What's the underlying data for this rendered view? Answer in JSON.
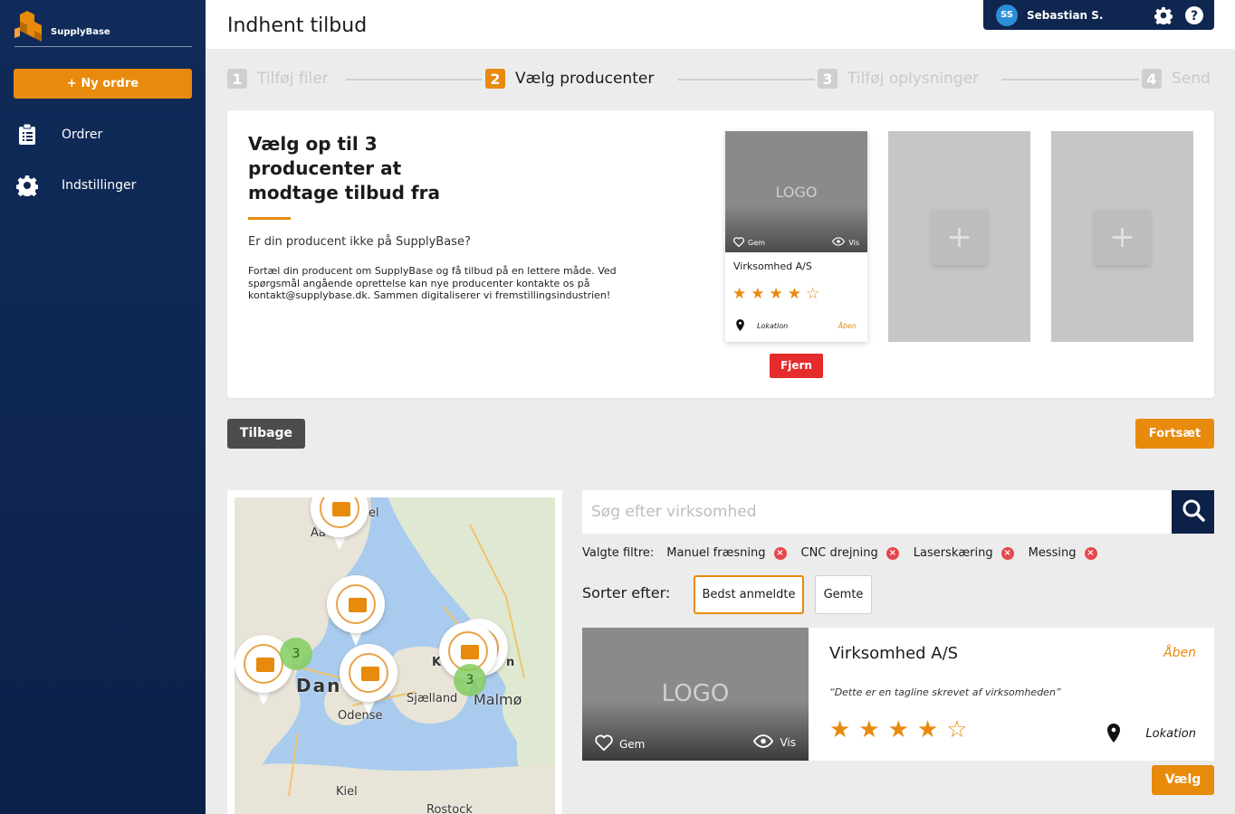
{
  "app": {
    "brand": "SupplyBase",
    "brand_color": "#e88a0c",
    "sidebar_color": "#0f2650"
  },
  "sidebar": {
    "new_order_label": "+ Ny ordre",
    "items": [
      {
        "label": "Ordrer",
        "icon": "clipboard-icon"
      },
      {
        "label": "Indstillinger",
        "icon": "gear-icon"
      }
    ]
  },
  "header": {
    "title": "Indhent tilbud",
    "user": {
      "initials": "SS",
      "name": "Sebastian S."
    }
  },
  "stepper": {
    "steps": [
      {
        "num": "1",
        "label": "Tilføj filer",
        "active": false
      },
      {
        "num": "2",
        "label": "Vælg producenter",
        "active": true
      },
      {
        "num": "3",
        "label": "Tilføj oplysninger",
        "active": false
      },
      {
        "num": "4",
        "label": "Send",
        "active": false
      }
    ]
  },
  "selection": {
    "title": "Vælg op til 3 producenter at modtage tilbud fra",
    "subtitle": "Er din producent ikke på SupplyBase?",
    "text": "Fortæl din producent om SupplyBase og få tilbud på en lettere måde. Ved spørgsmål  angående oprettelse kan nye producenter kontakte os på kontakt@supplybase.dk. Sammen digitaliserer vi fremstillingsindustrien!",
    "selected_card": {
      "logo": "LOGO",
      "save_label": "Gem",
      "view_label": "Vis",
      "name": "Virksomhed A/S",
      "stars": "★★★★☆",
      "rating": 4,
      "location": "Lokation",
      "status": "Åben"
    },
    "remove_label": "Fjern",
    "empty_slot_symbol": "+"
  },
  "actions": {
    "back_label": "Tilbage",
    "continue_label": "Fortsæt"
  },
  "map": {
    "labels": [
      "Dan",
      "Sjælland",
      "Malmø",
      "Odense",
      "Kiel",
      "Rostock",
      "el",
      "Aa",
      "K",
      "n"
    ],
    "clusters": [
      "3",
      "3"
    ]
  },
  "search": {
    "placeholder": "Søg efter virksomhed"
  },
  "filters": {
    "label": "Valgte filtre:",
    "items": [
      "Manuel fræsning",
      "CNC drejning",
      "Laserskæring",
      "Messing"
    ]
  },
  "sort": {
    "label": "Sorter efter:",
    "options": [
      "Bedst anmeldte",
      "Gemte"
    ],
    "selected": "Bedst anmeldte"
  },
  "result": {
    "logo": "LOGO",
    "save_label": "Gem",
    "view_label": "Vis",
    "name": "Virksomhed A/S",
    "status": "Åben",
    "tagline": "“Dette er en tagline skrevet af virksomheden”",
    "stars": "★★★★☆",
    "rating": 4,
    "location": "Lokation",
    "choose_label": "Vælg"
  }
}
